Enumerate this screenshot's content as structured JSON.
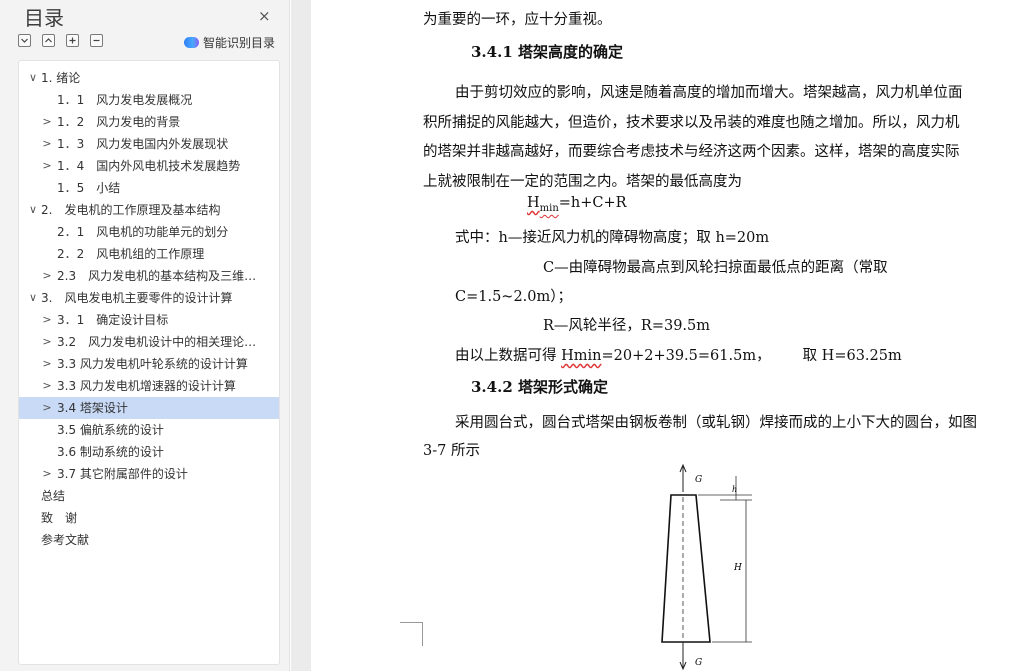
{
  "sidebar": {
    "title": "目录",
    "close_glyph": "×",
    "tools": {
      "expand_all": "+",
      "collapse_all": "−",
      "expand": "⊞",
      "collapse": "⊟"
    },
    "smart_toc_label": "智能识别目录",
    "smart_toc_icon": "cloud-ai-icon",
    "items": [
      {
        "label": "1. 绪论",
        "chev": "∨"
      },
      {
        "label": "1．1　风力发电发展概况",
        "chev": ""
      },
      {
        "label": "1．2　风力发电的背景",
        "chev": ">"
      },
      {
        "label": "1．3　风力发电国内外发展现状",
        "chev": ">"
      },
      {
        "label": "1．4　国内外风电机技术发展趋势",
        "chev": ">"
      },
      {
        "label": "1．5　小结",
        "chev": ""
      },
      {
        "label": "2.　发电机的工作原理及基本结构",
        "chev": "∨"
      },
      {
        "label": "2．1　风电机的功能单元的划分",
        "chev": ""
      },
      {
        "label": "2．2　风电机组的工作原理",
        "chev": ""
      },
      {
        "label": "2.3　风力发电机的基本结构及三维…",
        "chev": ">"
      },
      {
        "label": "3.　风电发电机主要零件的设计计算",
        "chev": "∨"
      },
      {
        "label": "3．1　确定设计目标",
        "chev": ">"
      },
      {
        "label": "3.2　风力发电机设计中的相关理论…",
        "chev": ">"
      },
      {
        "label": "3.3 风力发电机叶轮系统的设计计算",
        "chev": ">"
      },
      {
        "label": "3.3 风力发电机增速器的设计计算",
        "chev": ">"
      },
      {
        "label": "3.4 塔架设计",
        "chev": ">",
        "selected": true
      },
      {
        "label": "3.5 偏航系统的设计",
        "chev": ""
      },
      {
        "label": "3.6 制动系统的设计",
        "chev": ""
      },
      {
        "label": "3.7 其它附属部件的设计",
        "chev": ">"
      },
      {
        "label": "总结",
        "chev": ""
      },
      {
        "label": "致　谢",
        "chev": ""
      },
      {
        "label": "参考文献",
        "chev": ""
      }
    ]
  },
  "document": {
    "line_prev": "为重要的一环，应十分重视。",
    "heading_341": "3.4.1  塔架高度的确定",
    "para1": [
      "由于剪切效应的影响，风速是随着高度的增加而增大。塔架越高，风力机单位面",
      "积所捕捉的风能越大，但造价，技术要求以及吊装的难度也随之增加。所以，风力机",
      "的塔架并非越高越好，而要综合考虑技术与经济这两个因素。这样，塔架的高度实际",
      "上就被限制在一定的范围之内。塔架的最低高度为"
    ],
    "formula_h": "H",
    "formula_sub": "min",
    "formula_rest": "=h+C+R",
    "where_h": "式中：h—接近风力机的障碍物高度；取 h=20m",
    "where_c1": "C—由障碍物最高点到风轮扫掠面最低点的距离（常取",
    "where_c2": "C=1.5~2.0m）；",
    "where_r": "R—风轮半径，R=39.5m",
    "result_prefix": "由以上数据可得 ",
    "result_hmin": "Hmin",
    "result_mid": "=20+2+39.5=61.5m，",
    "result_take": "取 H=63.25m",
    "heading_342": "3.4.2  塔架形式确定",
    "para2_line1": "采用圆台式，圆台式塔架由钢板卷制（或轧钢）焊接而成的上小下大的圆台，如图",
    "para2_line2": "3-7 所示",
    "figure_labels": {
      "g_top": "G",
      "g_bottom": "G",
      "h_small": "h",
      "h_big": "H"
    }
  }
}
